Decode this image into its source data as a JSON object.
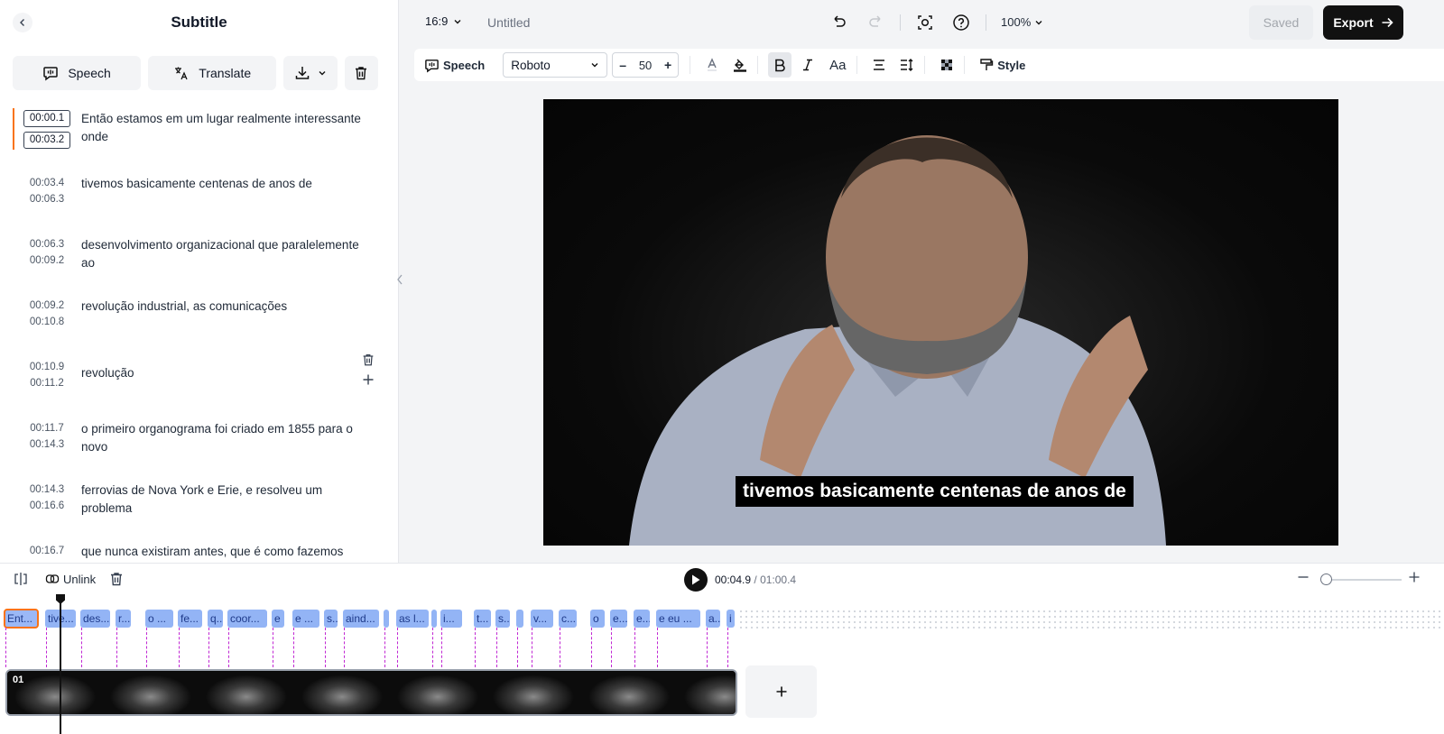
{
  "panel": {
    "title": "Subtitle",
    "speech_label": "Speech",
    "translate_label": "Translate"
  },
  "subtitles": [
    {
      "start": "00:00.1",
      "end": "00:03.2",
      "text": "Então estamos em um lugar realmente interessante onde"
    },
    {
      "start": "00:03.4",
      "end": "00:06.3",
      "text": "tivemos basicamente centenas de anos de"
    },
    {
      "start": "00:06.3",
      "end": "00:09.2",
      "text": "desenvolvimento organizacional que paralelemente ao"
    },
    {
      "start": "00:09.2",
      "end": "00:10.8",
      "text": "revolução industrial, as comunicações"
    },
    {
      "start": "00:10.9",
      "end": "00:11.2",
      "text": "revolução"
    },
    {
      "start": "00:11.7",
      "end": "00:14.3",
      "text": "o primeiro organograma foi criado em 1855 para o novo"
    },
    {
      "start": "00:14.3",
      "end": "00:16.6",
      "text": "ferrovias de Nova York e Erie, e resolveu um problema"
    },
    {
      "start": "00:16.7",
      "end": "",
      "text": "que nunca existiram antes, que é como fazemos"
    }
  ],
  "topbar": {
    "aspect_ratio": "16:9",
    "project_title": "Untitled",
    "zoom": "100%",
    "saved_label": "Saved",
    "export_label": "Export"
  },
  "format": {
    "speech_label": "Speech",
    "font": "Roboto",
    "font_size": "50",
    "minus": "–",
    "plus": "+",
    "case_label": "Aa",
    "style_label": "Style"
  },
  "video": {
    "caption": "tivemos basicamente centenas de anos de"
  },
  "timeline": {
    "unlink_label": "Unlink",
    "current_time": "00:04.9",
    "total_time": "01:00.4",
    "track_label": "01",
    "chips": [
      "Ent...",
      "tive...",
      "des...",
      "r...",
      "o ...",
      "fe...",
      "q...",
      "coor...",
      "e",
      "e ...",
      "s...",
      "aind...",
      "",
      "as l...",
      "",
      "i...",
      "t...",
      "s...",
      "",
      "v...",
      "c...",
      "o",
      "e...",
      "e...",
      "e eu ...",
      "a...",
      "i"
    ]
  }
}
